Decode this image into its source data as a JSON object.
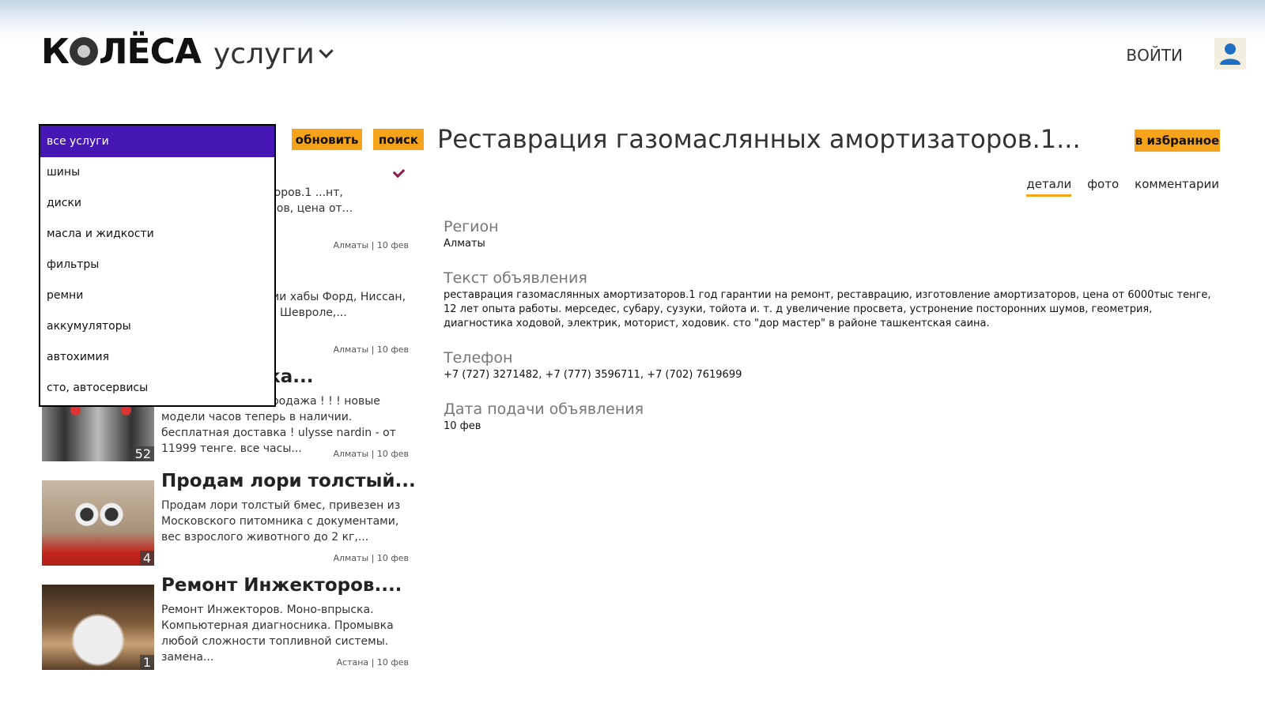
{
  "header": {
    "logo_text_left": "К",
    "logo_text_right": "ЛЁСА",
    "section_title": "услуги",
    "login_label": "ВОЙТИ"
  },
  "toolbar": {
    "refresh_label": "обновить",
    "search_label": "поиск",
    "favorite_label": "в избранное"
  },
  "category_dropdown": {
    "items": [
      "все услуги",
      "шины",
      "диски",
      "масла и жидкости",
      "фильтры",
      "ремни",
      "аккумуляторы",
      "автохимия",
      "сто, автосервисы"
    ],
    "selected_index": 0
  },
  "listings": [
    {
      "title": "...",
      "description": "...ннных амортизаторов.1 ...нт, реставрацию, ...торов, цена от...",
      "meta": "Алматы | 10 фев",
      "photo_count": ""
    },
    {
      "title": "",
      "description": "...ручные). В наличии хабы Форд, Ниссан, Тойота, ...одж, Киа, Шевроле,...",
      "meta": "Алматы | 10 фев",
      "photo_count": ""
    },
    {
      "title": "распродажа...",
      "description": "14.999 тенге! распродажа ! ! ! новые модели часов теперь в наличии. бесплатная доставка ! ulysse nardin - от 11999 тенге. все часы...",
      "meta": "Алматы | 10 фев",
      "photo_count": "52"
    },
    {
      "title": "Продам лори толстый...",
      "description": "Продам лори толстый 6мес, привезен из Московского питомника с документами, вес взрослого животного до 2 кг,...",
      "meta": "Алматы | 10 фев",
      "photo_count": "4"
    },
    {
      "title": "Ремонт Инжекторов....",
      "description": "Ремонт Инжекторов. Моно-впрыска. Компьютерная диагносника. Промывка любой сложности топливной системы. замена...",
      "meta": "Астана | 10 фев",
      "photo_count": "1"
    }
  ],
  "detail": {
    "title": "Реставрация газомаслянных амортизаторов.1...",
    "tabs": [
      "детали",
      "фото",
      "комментарии"
    ],
    "active_tab": 0,
    "region_label": "Регион",
    "region_value": "Алматы",
    "text_label": "Текст объявления",
    "text_value": "реставрация газомаслянных амортизаторов.1 год гарантии на ремонт, реставрацию, изготовление амортизаторов, цена от 6000тыс тенге, 12 лет опыта работы. мерседес, субару, сузуки, тойота и. т. д увеличение просвета, устронение посторонних шумов, геометрия, диагностика ходовой, электрик, моторист, ходовик. сто \"дор мастер\" в районе ташкентская саина.",
    "phone_label": "Телефон",
    "phone_value": "+7 (727) 3271482, +7 (777) 3596711, +7 (702) 7619699",
    "date_label": "Дата подачи объявления",
    "date_value": "10 фев"
  },
  "colors": {
    "accent": "#f5a31a",
    "dropdown_selected": "#4617b4",
    "check": "#8b1a4e"
  }
}
